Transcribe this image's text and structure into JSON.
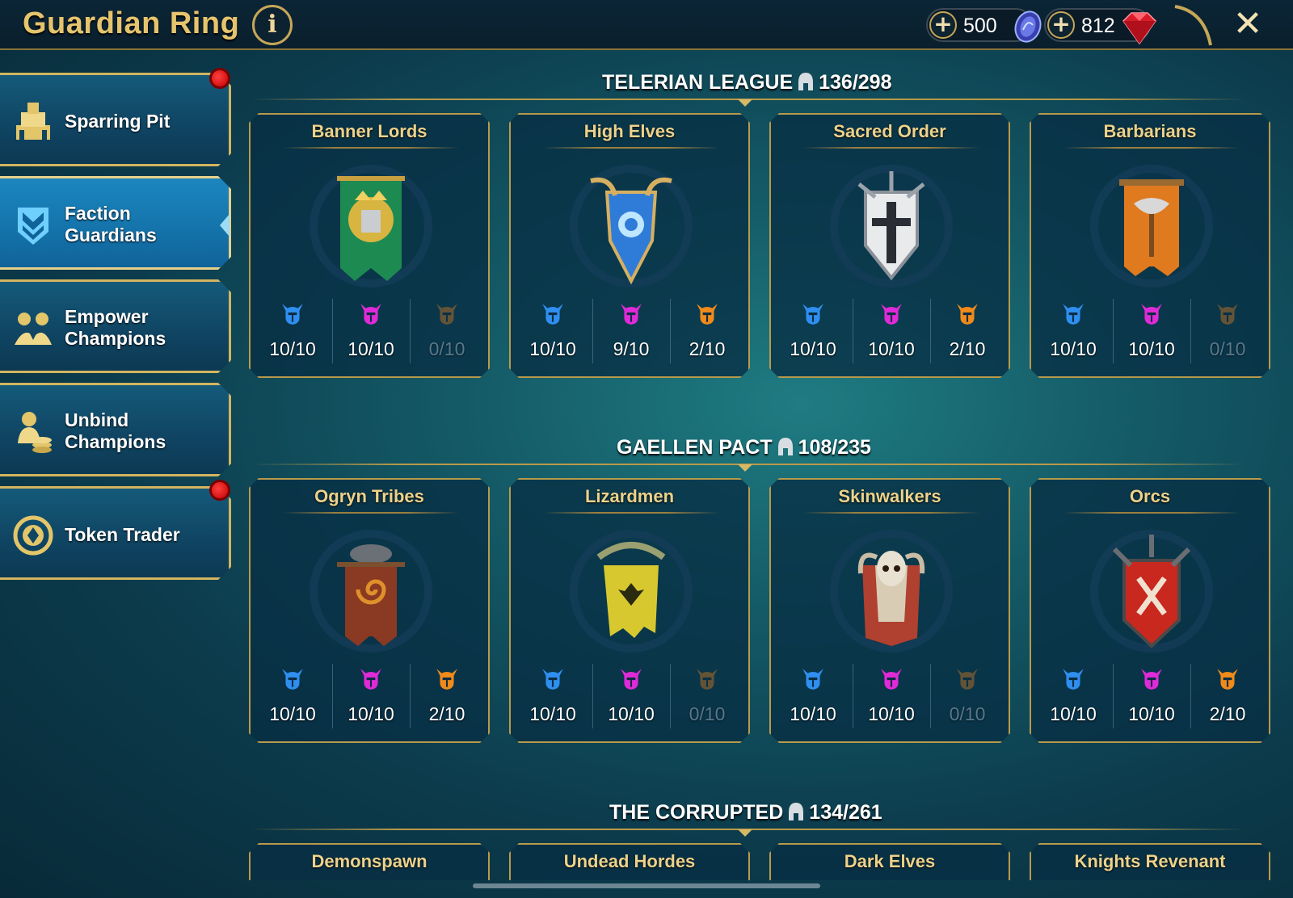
{
  "header": {
    "title": "Guardian Ring",
    "info_label": "i",
    "close_label": "✕",
    "currencies": [
      {
        "name": "silver-coins",
        "value": "500",
        "plus": "+",
        "icon": "blue-coin-icon"
      },
      {
        "name": "gems",
        "value": "812",
        "plus": "+",
        "icon": "ruby-gem-icon"
      }
    ]
  },
  "sidebar": {
    "items": [
      {
        "label_line1": "Sparring Pit",
        "label_line2": "",
        "icon": "sparring-pit-icon",
        "active": false,
        "notification": true
      },
      {
        "label_line1": "Faction",
        "label_line2": "Guardians",
        "icon": "faction-guardians-icon",
        "active": true,
        "notification": false
      },
      {
        "label_line1": "Empower",
        "label_line2": "Champions",
        "icon": "empower-champions-icon",
        "active": false,
        "notification": false
      },
      {
        "label_line1": "Unbind",
        "label_line2": "Champions",
        "icon": "unbind-champions-icon",
        "active": false,
        "notification": false
      },
      {
        "label_line1": "Token Trader",
        "label_line2": "",
        "icon": "token-trader-icon",
        "active": false,
        "notification": true
      }
    ]
  },
  "rarity_colors": {
    "rare": "#2f8ff0",
    "epic": "#e02ad8",
    "legendary": "#f08a1a"
  },
  "sections": [
    {
      "title": "TELERIAN LEAGUE",
      "count": "136/298",
      "factions": [
        {
          "name": "Banner Lords",
          "emblem": "banner-lords-emblem-icon",
          "rare": "10/10",
          "epic": "10/10",
          "legendary": "0/10",
          "legendary_dim": true
        },
        {
          "name": "High Elves",
          "emblem": "high-elves-emblem-icon",
          "rare": "10/10",
          "epic": "9/10",
          "legendary": "2/10",
          "legendary_dim": false
        },
        {
          "name": "Sacred Order",
          "emblem": "sacred-order-emblem-icon",
          "rare": "10/10",
          "epic": "10/10",
          "legendary": "2/10",
          "legendary_dim": false
        },
        {
          "name": "Barbarians",
          "emblem": "barbarians-emblem-icon",
          "rare": "10/10",
          "epic": "10/10",
          "legendary": "0/10",
          "legendary_dim": true
        }
      ]
    },
    {
      "title": "GAELLEN PACT",
      "count": "108/235",
      "factions": [
        {
          "name": "Ogryn Tribes",
          "emblem": "ogryn-tribes-emblem-icon",
          "rare": "10/10",
          "epic": "10/10",
          "legendary": "2/10",
          "legendary_dim": false
        },
        {
          "name": "Lizardmen",
          "emblem": "lizardmen-emblem-icon",
          "rare": "10/10",
          "epic": "10/10",
          "legendary": "0/10",
          "legendary_dim": true
        },
        {
          "name": "Skinwalkers",
          "emblem": "skinwalkers-emblem-icon",
          "rare": "10/10",
          "epic": "10/10",
          "legendary": "0/10",
          "legendary_dim": true
        },
        {
          "name": "Orcs",
          "emblem": "orcs-emblem-icon",
          "rare": "10/10",
          "epic": "10/10",
          "legendary": "2/10",
          "legendary_dim": false
        }
      ]
    },
    {
      "title": "THE CORRUPTED",
      "count": "134/261",
      "factions": [
        {
          "name": "Demonspawn"
        },
        {
          "name": "Undead Hordes"
        },
        {
          "name": "Dark Elves"
        },
        {
          "name": "Knights Revenant"
        }
      ]
    }
  ]
}
